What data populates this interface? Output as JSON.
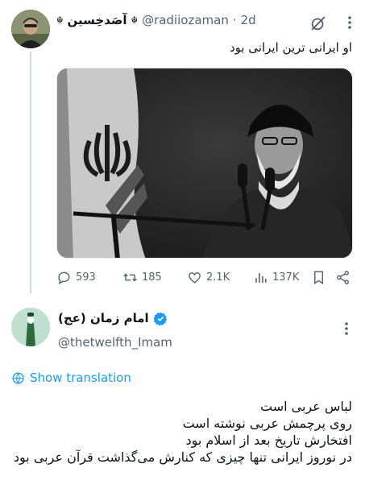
{
  "tweet1": {
    "display_name": "آصَدخِسین",
    "flag_glyph": "☬",
    "handle": "@radiiozaman",
    "separator": "·",
    "time": "2d",
    "text": "او ایرانی ترین ایرانی بود",
    "media_icon": "news-photo",
    "stats": {
      "replies": "593",
      "reposts": "185",
      "likes": "2.1K",
      "views": "137K"
    },
    "icons": [
      "grok-icon",
      "more-icon",
      "reply-icon",
      "repost-icon",
      "like-icon",
      "views-icon",
      "bookmark-icon",
      "share-icon"
    ]
  },
  "tweet2": {
    "display_name": "امام زمان (عج)",
    "handle": "@thetwelfth_Imam",
    "verified_color": "#1d9bf0",
    "show_translation": "Show translation",
    "lines": [
      "لباس عربی است",
      "روی پرچمش عربی نوشته است",
      "افتخارش تاریخ بعد از اسلام بود",
      "در نوروز ایرانی تنها چیزی که کنارش می‌گذاشت قرآن عربی بود"
    ]
  },
  "colors": {
    "accent": "#1d9bf0",
    "muted": "#536471",
    "line": "#cfd9de"
  }
}
